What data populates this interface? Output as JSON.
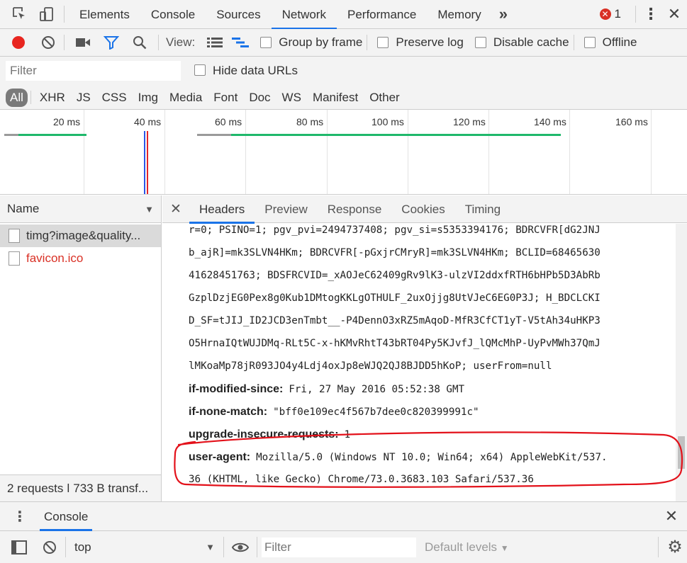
{
  "topbar": {
    "tabs": [
      "Elements",
      "Console",
      "Sources",
      "Network",
      "Performance",
      "Memory"
    ],
    "more": "»",
    "error_count": "1"
  },
  "network_toolbar": {
    "view_label": "View:",
    "group_by_frame": "Group by frame",
    "preserve_log": "Preserve log",
    "disable_cache": "Disable cache",
    "offline": "Offline"
  },
  "filter": {
    "placeholder": "Filter",
    "hide_data_urls": "Hide data URLs"
  },
  "types": [
    "All",
    "XHR",
    "JS",
    "CSS",
    "Img",
    "Media",
    "Font",
    "Doc",
    "WS",
    "Manifest",
    "Other"
  ],
  "overview": {
    "ticks": [
      "20 ms",
      "40 ms",
      "60 ms",
      "80 ms",
      "100 ms",
      "120 ms",
      "140 ms",
      "160 ms"
    ]
  },
  "requests": {
    "column_name": "Name",
    "items": [
      {
        "name": "timg?image&quality...",
        "color": "#333333"
      },
      {
        "name": "favicon.ico",
        "color": "#d93025"
      }
    ],
    "status": "2 requests ǀ 733 B transf..."
  },
  "details": {
    "tabs": [
      "Headers",
      "Preview",
      "Response",
      "Cookies",
      "Timing"
    ],
    "cookie_lines": [
      "r=0; PSINO=1; pgv_pvi=2494737408; pgv_si=s5353394176; BDRCVFR[dG2JNJ",
      "b_ajR]=mk3SLVN4HKm; BDRCVFR[-pGxjrCMryR]=mk3SLVN4HKm; BCLID=68465630",
      "41628451763; BDSFRCVID=_xAOJeC62409gRv9lK3-ulzVI2ddxfRTH6bHPb5D3AbRb",
      "GzplDzjEG0Pex8g0Kub1DMtogKKLgOTHULF_2uxOjjg8UtVJeC6EG0P3J; H_BDCLCKI",
      "D_SF=tJIJ_ID2JCD3enTmbt__-P4DennO3xRZ5mAqoD-MfR3CfCT1yT-V5tAh34uHKP3",
      "O5HrnaIQtWUJDMq-RLt5C-x-hKMvRhtT43bRT04Py5KJvfJ_lQMcMhP-UyPvMWh37QmJ",
      "lMKoaMp78jR093JO4y4Ldj4oxJp8eWJQ2QJ8BJDD5hKoP; userFrom=null"
    ],
    "headers": [
      {
        "key": "if-modified-since:",
        "value": "Fri, 27 May 2016 05:52:38 GMT"
      },
      {
        "key": "if-none-match:",
        "value": "\"bff0e109ec4f567b7dee0c820399991c\""
      },
      {
        "key": "upgrade-insecure-requests:",
        "value": "1"
      }
    ],
    "user_agent_key": "user-agent:",
    "user_agent_line1": "Mozilla/5.0 (Windows NT 10.0; Win64; x64) AppleWebKit/537.",
    "user_agent_line2": "36 (KHTML, like Gecko) Chrome/73.0.3683.103 Safari/537.36"
  },
  "drawer": {
    "tab": "Console",
    "context": "top",
    "filter_placeholder": "Filter",
    "levels": "Default levels"
  },
  "colors": {
    "accent": "#1a73e8",
    "record": "#e8251f",
    "annotation": "#e3111a",
    "waterfall_green": "#1fb86b",
    "waterfall_grey": "#9a9a9a"
  },
  "icons": [
    "inspect-icon",
    "device-icon",
    "error-icon",
    "kebab-icon",
    "close-icon",
    "record-icon",
    "clear-icon",
    "camera-icon",
    "filter-icon",
    "search-icon",
    "list-view-icon",
    "waterfall-view-icon",
    "sort-arrow-icon",
    "file-icon",
    "sidebar-toggle-icon",
    "eye-icon",
    "gear-icon"
  ]
}
